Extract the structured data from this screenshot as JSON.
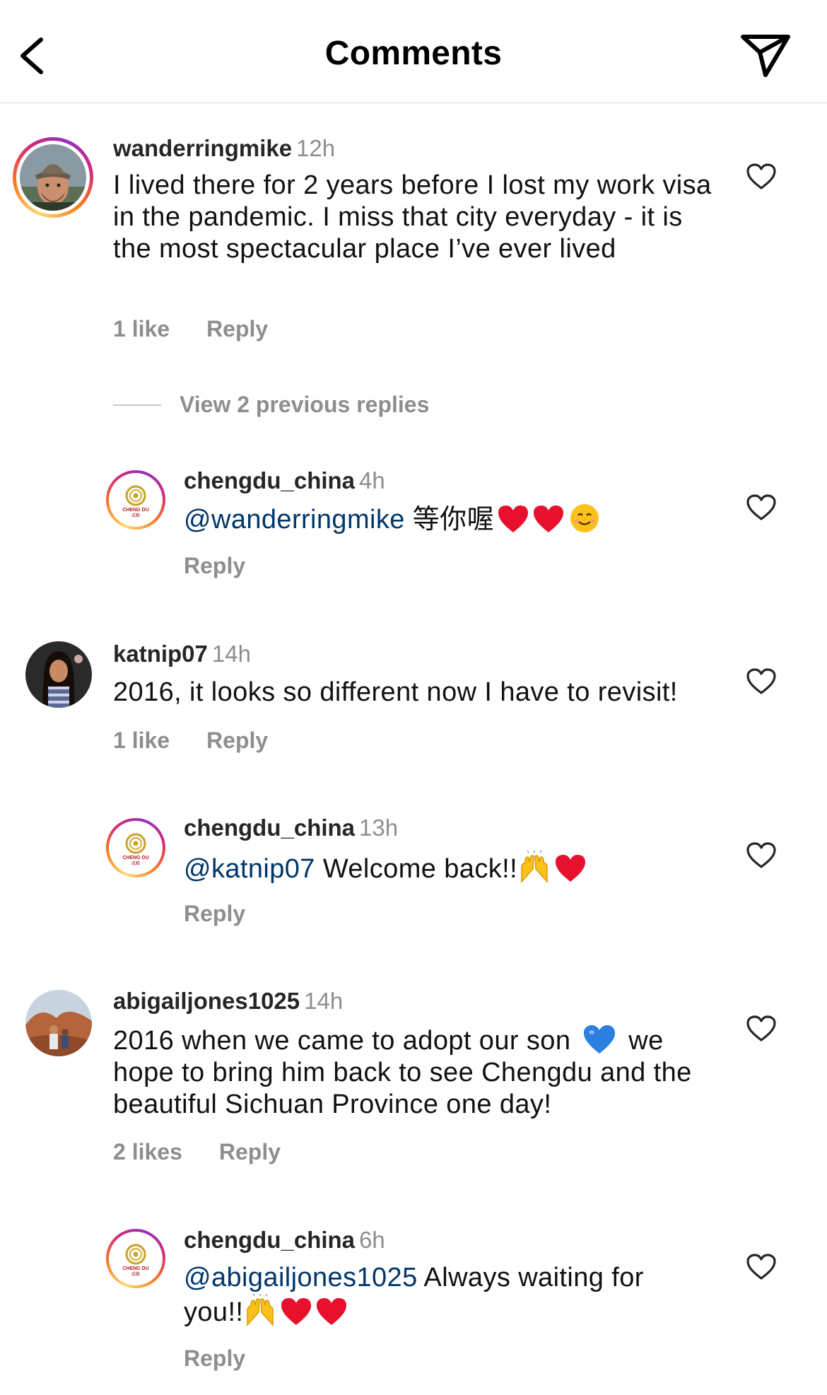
{
  "header": {
    "title": "Comments"
  },
  "comments": [
    {
      "username": "wanderringmike",
      "time": "12h",
      "text": "I lived there for 2 years before I lost my work visa in the pandemic. I miss that city everyday - it is the most spectacular place I’ve ever lived",
      "likes": "1 like",
      "reply": "Reply"
    },
    {
      "view_replies": "View 2 previous replies"
    },
    {
      "username": "chengdu_china",
      "time": "4h",
      "mention": "@wanderringmike",
      "text": " 等你喔",
      "reply": "Reply"
    },
    {
      "username": "katnip07",
      "time": "14h",
      "text": "2016, it looks so different now I have to revisit!",
      "likes": "1 like",
      "reply": "Reply"
    },
    {
      "username": "chengdu_china",
      "time": "13h",
      "mention": "@katnip07",
      "text": " Welcome back!!",
      "reply": "Reply"
    },
    {
      "username": "abigailjones1025",
      "time": "14h",
      "text_before": "2016 when we came to adopt our son ",
      "text_after": " we hope to bring him back to see Chengdu and the beautiful Sichuan Province one day!",
      "likes": "2 likes",
      "reply": "Reply"
    },
    {
      "username": "chengdu_china",
      "time": "6h",
      "mention": "@abigailjones1025",
      "text": " Always waiting for you!!",
      "reply": "Reply"
    }
  ],
  "logo": {
    "line1": "CHENG DU",
    "line2": "成都"
  },
  "colors": {
    "mention": "#00376b",
    "secondary_text": "#8e8e8e",
    "heart_red": "#e8112d",
    "logo_gold": "#c9a227",
    "logo_red": "#b01e23"
  },
  "icons": {
    "back": "chevron-left-icon",
    "share": "paper-plane-icon",
    "like": "heart-outline-icon"
  }
}
